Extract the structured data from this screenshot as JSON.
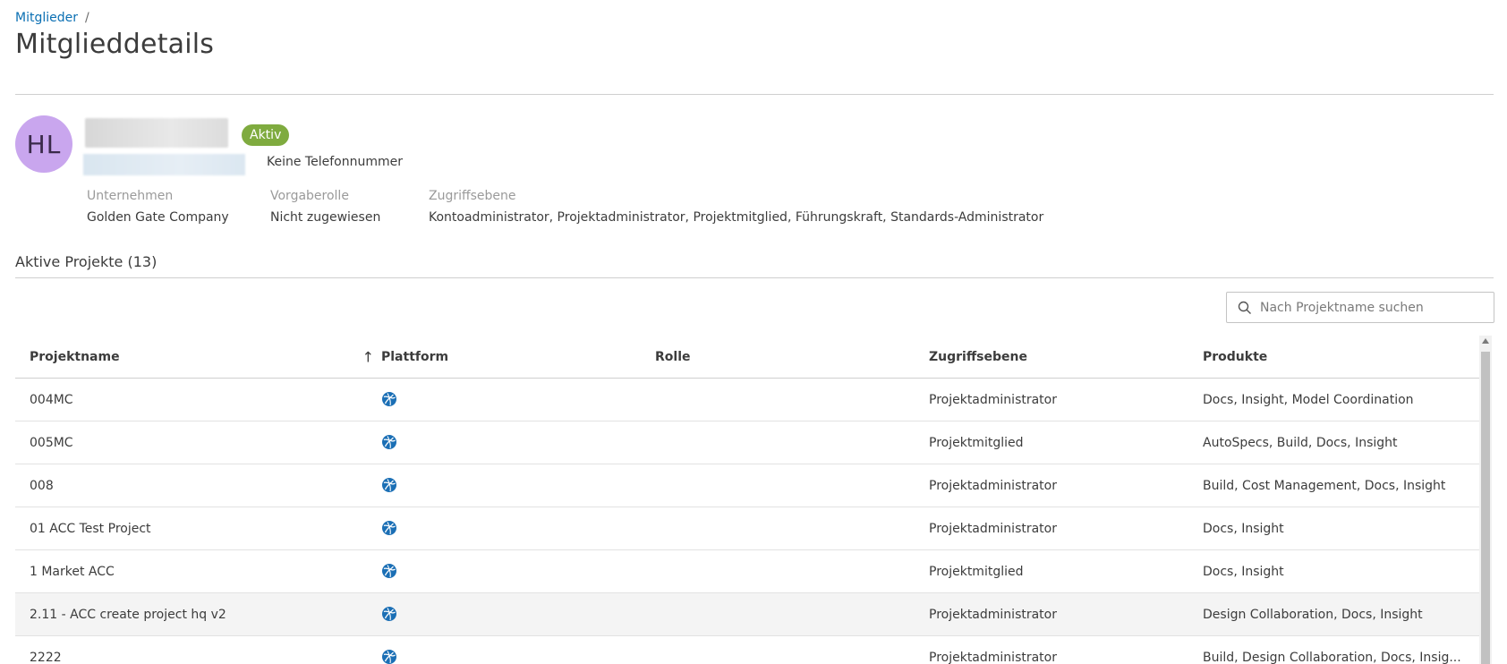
{
  "breadcrumb": {
    "parent": "Mitglieder",
    "separator": "/"
  },
  "page_title": "Mitglieddetails",
  "member": {
    "initials": "HL",
    "status": "Aktiv",
    "phone": "Keine Telefonnummer",
    "company_label": "Unternehmen",
    "company_value": "Golden Gate Company",
    "role_label": "Vorgaberolle",
    "role_value": "Nicht zugewiesen",
    "access_label": "Zugriffsebene",
    "access_value": "Kontoadministrator, Projektadministrator, Projektmitglied, Führungskraft, Standards-Administrator"
  },
  "projects": {
    "title": "Aktive Projekte (13)",
    "search_placeholder": "Nach Projektname suchen",
    "columns": {
      "name": "Projektname",
      "platform": "Plattform",
      "role": "Rolle",
      "access": "Zugriffsebene",
      "products": "Produkte"
    },
    "rows": [
      {
        "name": "004MC",
        "platform_icon": "globe-icon",
        "role": "",
        "access": "Projektadministrator",
        "products": "Docs, Insight, Model Coordination"
      },
      {
        "name": "005MC",
        "platform_icon": "globe-icon",
        "role": "",
        "access": "Projektmitglied",
        "products": "AutoSpecs, Build, Docs, Insight"
      },
      {
        "name": "008",
        "platform_icon": "globe-icon",
        "role": "",
        "access": "Projektadministrator",
        "products": "Build, Cost Management, Docs, Insight"
      },
      {
        "name": "01 ACC Test Project",
        "platform_icon": "globe-icon",
        "role": "",
        "access": "Projektadministrator",
        "products": "Docs, Insight"
      },
      {
        "name": "1 Market ACC",
        "platform_icon": "globe-icon",
        "role": "",
        "access": "Projektmitglied",
        "products": "Docs, Insight"
      },
      {
        "name": "2.11 - ACC create project hq v2",
        "platform_icon": "globe-icon",
        "role": "",
        "access": "Projektadministrator",
        "products": "Design Collaboration, Docs, Insight"
      },
      {
        "name": "2222",
        "platform_icon": "globe-icon",
        "role": "",
        "access": "Projektadministrator",
        "products": "Build, Design Collaboration, Docs, Insig..."
      }
    ]
  },
  "colors": {
    "link": "#0a6fb3",
    "badge": "#7fab3f",
    "avatar": "#c9a6ee",
    "platform": "#1b6fb5"
  }
}
